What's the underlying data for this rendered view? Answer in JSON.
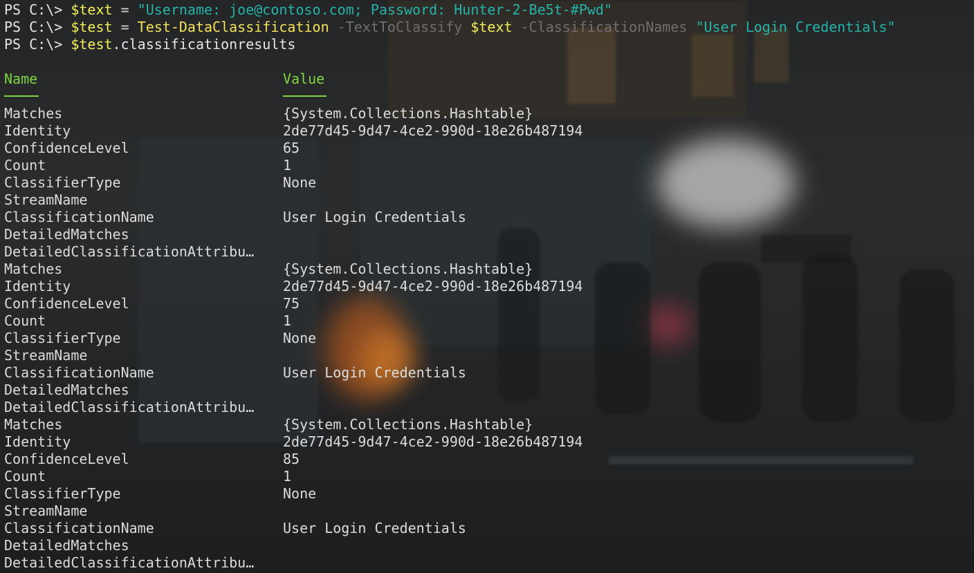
{
  "commands": [
    {
      "prompt": "PS C:\\> ",
      "var": "$text",
      "op": " = ",
      "str": "\"Username: joe@contoso.com; Password: Hunter-2-Be5t-#Pwd\""
    },
    {
      "prompt": "PS C:\\> ",
      "var": "$test",
      "op": " = ",
      "cmdlet": "Test-DataClassification",
      "param1": " -TextToClassify ",
      "arg1": "$text",
      "param2": " -ClassificationNames ",
      "arg2": "\"User Login Credentials\""
    },
    {
      "prompt": "PS C:\\> ",
      "var": "$test",
      "rest": ".classificationresults"
    }
  ],
  "table": {
    "col_name": "Name",
    "col_value": "Value",
    "rows": [
      {
        "k": "Matches",
        "v": "{System.Collections.Hashtable}"
      },
      {
        "k": "Identity",
        "v": "2de77d45-9d47-4ce2-990d-18e26b487194"
      },
      {
        "k": "ConfidenceLevel",
        "v": "65"
      },
      {
        "k": "Count",
        "v": "1"
      },
      {
        "k": "ClassifierType",
        "v": "None"
      },
      {
        "k": "StreamName",
        "v": ""
      },
      {
        "k": "ClassificationName",
        "v": "User Login Credentials"
      },
      {
        "k": "DetailedMatches",
        "v": ""
      },
      {
        "k": "DetailedClassificationAttribu…",
        "v": ""
      },
      {
        "k": "Matches",
        "v": "{System.Collections.Hashtable}"
      },
      {
        "k": "Identity",
        "v": "2de77d45-9d47-4ce2-990d-18e26b487194"
      },
      {
        "k": "ConfidenceLevel",
        "v": "75"
      },
      {
        "k": "Count",
        "v": "1"
      },
      {
        "k": "ClassifierType",
        "v": "None"
      },
      {
        "k": "StreamName",
        "v": ""
      },
      {
        "k": "ClassificationName",
        "v": "User Login Credentials"
      },
      {
        "k": "DetailedMatches",
        "v": ""
      },
      {
        "k": "DetailedClassificationAttribu…",
        "v": ""
      },
      {
        "k": "Matches",
        "v": "{System.Collections.Hashtable}"
      },
      {
        "k": "Identity",
        "v": "2de77d45-9d47-4ce2-990d-18e26b487194"
      },
      {
        "k": "ConfidenceLevel",
        "v": "85"
      },
      {
        "k": "Count",
        "v": "1"
      },
      {
        "k": "ClassifierType",
        "v": "None"
      },
      {
        "k": "StreamName",
        "v": ""
      },
      {
        "k": "ClassificationName",
        "v": "User Login Credentials"
      },
      {
        "k": "DetailedMatches",
        "v": ""
      },
      {
        "k": "DetailedClassificationAttribu…",
        "v": ""
      }
    ]
  },
  "colors": {
    "header": "#7fd641",
    "string": "#25b3a8",
    "variable": "#f2ee5a",
    "parameter": "#6f6f6f",
    "text": "#dcdcdc",
    "background": "#1b1d1f"
  }
}
